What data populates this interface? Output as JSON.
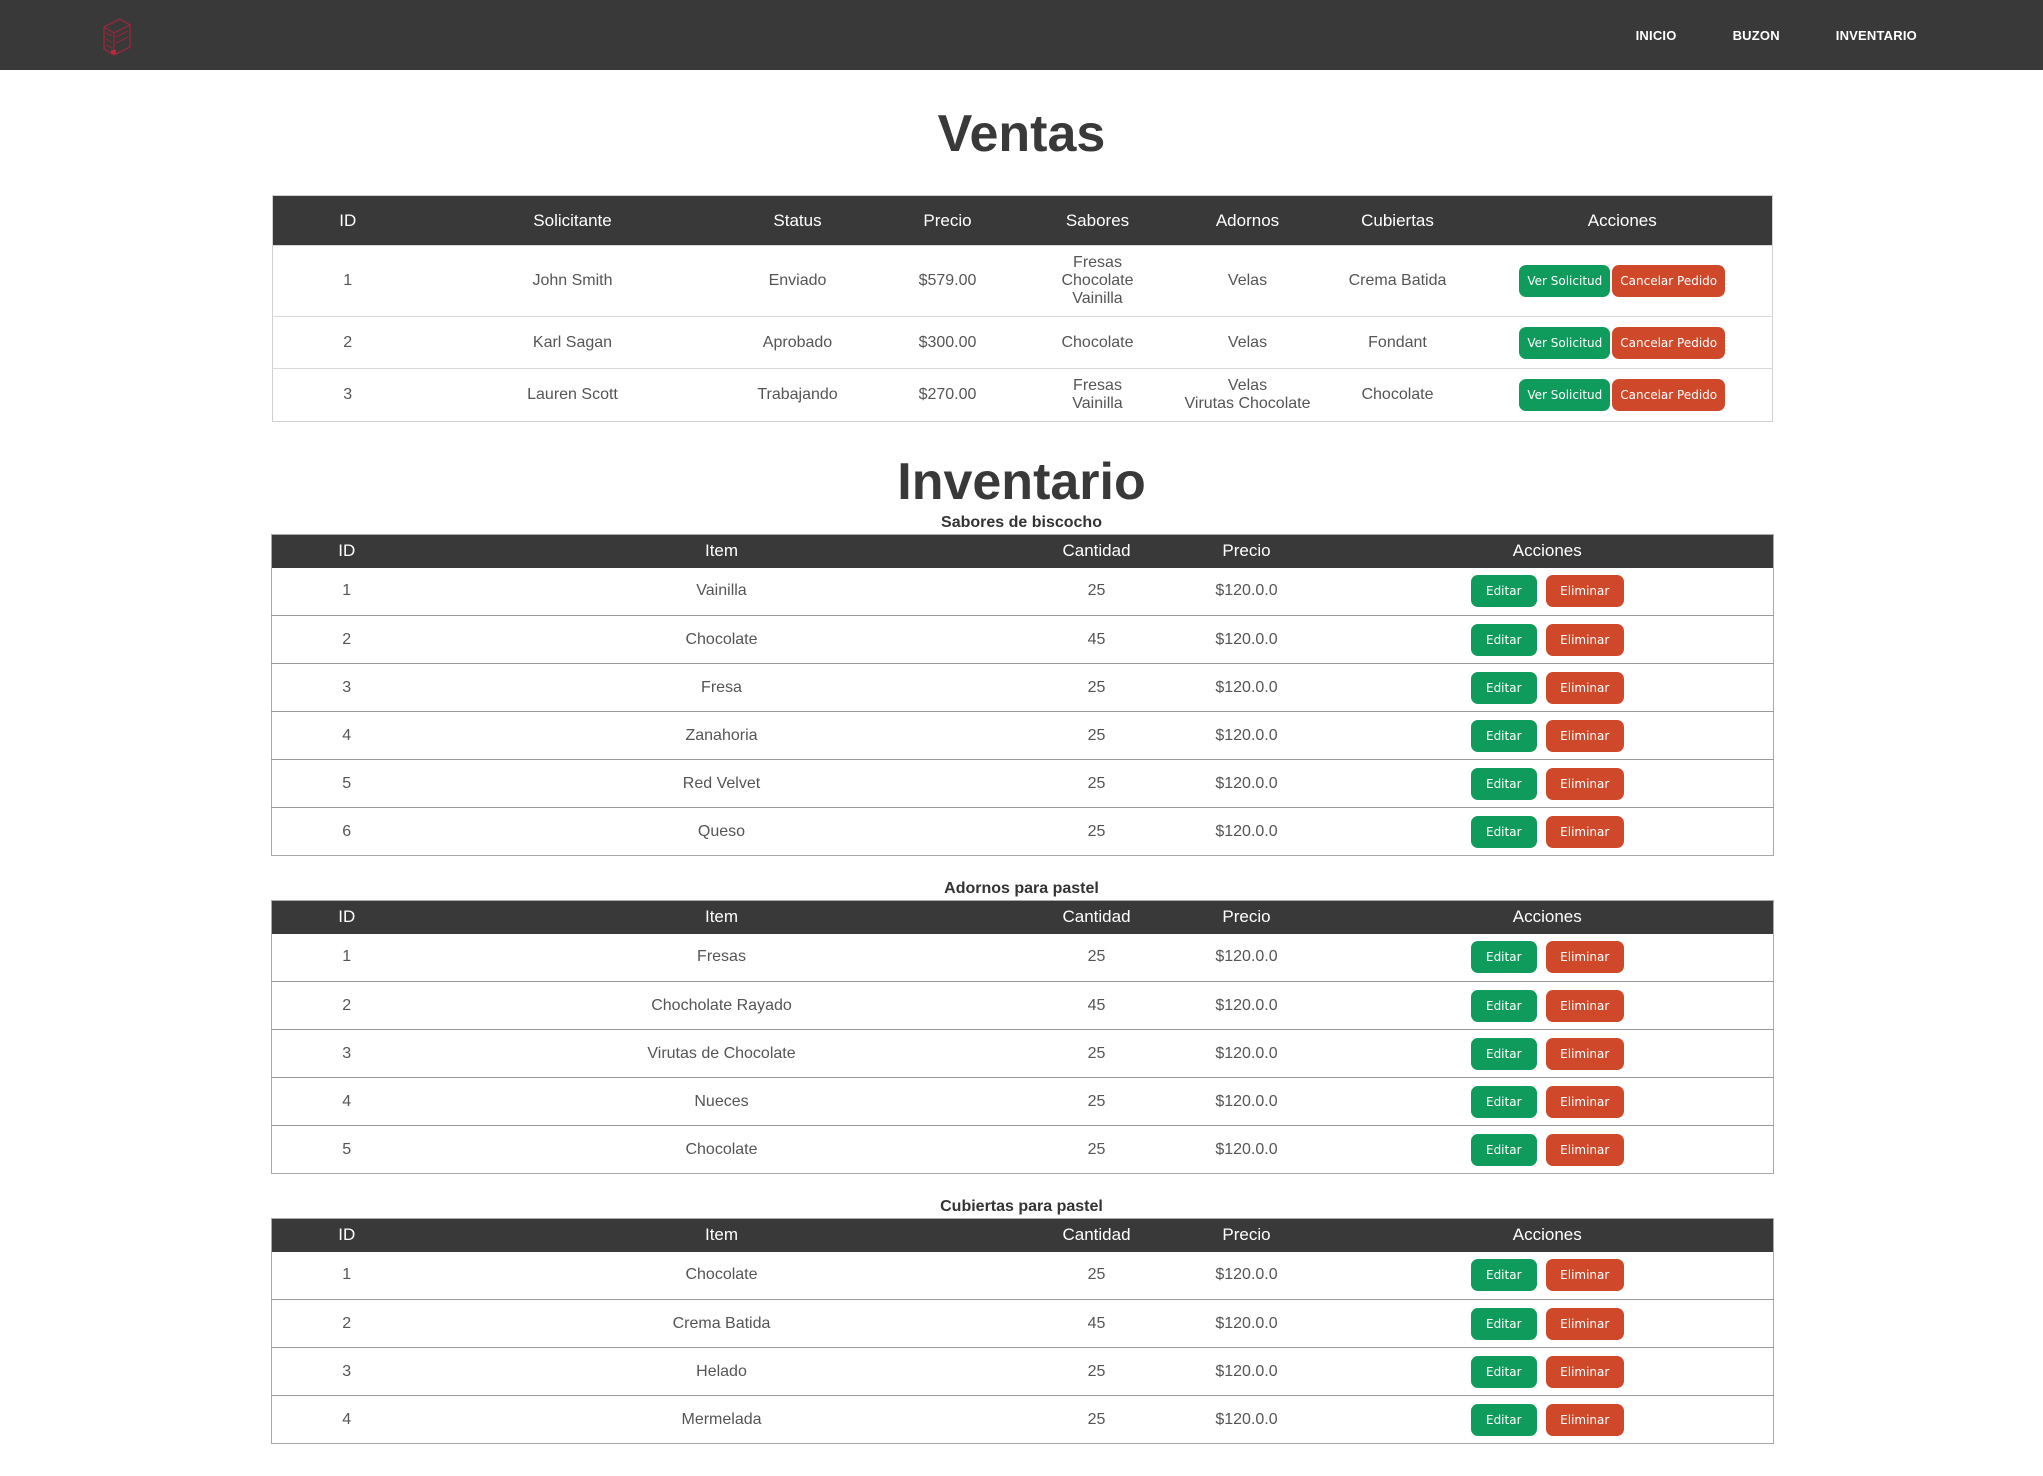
{
  "nav": {
    "logo_icon": "cake-logo-icon",
    "links": [
      "INICIO",
      "BUZON",
      "INVENTARIO"
    ]
  },
  "ventas": {
    "title": "Ventas",
    "headers": [
      "ID",
      "Solicitante",
      "Status",
      "Precio",
      "Sabores",
      "Adornos",
      "Cubiertas",
      "Acciones"
    ],
    "rows": [
      {
        "id": "1",
        "solicitante": "John Smith",
        "status": "Enviado",
        "precio": "$579.00",
        "sabores": [
          "Fresas",
          "Chocolate",
          "Vainilla"
        ],
        "adornos": [
          "Velas"
        ],
        "cubiertas": "Crema Batida"
      },
      {
        "id": "2",
        "solicitante": "Karl Sagan",
        "status": "Aprobado",
        "precio": "$300.00",
        "sabores": [
          "Chocolate"
        ],
        "adornos": [
          "Velas"
        ],
        "cubiertas": "Fondant"
      },
      {
        "id": "3",
        "solicitante": "Lauren Scott",
        "status": "Trabajando",
        "precio": "$270.00",
        "sabores": [
          "Fresas",
          "Vainilla"
        ],
        "adornos": [
          "Velas",
          "Virutas Chocolate"
        ],
        "cubiertas": "Chocolate"
      }
    ],
    "ver_label": "Ver Solicitud",
    "cancelar_label": "Cancelar Pedido"
  },
  "inventario": {
    "title": "Inventario",
    "headers": [
      "ID",
      "Item",
      "Cantidad",
      "Precio",
      "Acciones"
    ],
    "edit_label": "Editar",
    "delete_label": "Eliminar",
    "sections": [
      {
        "subtitle": "Sabores de biscocho",
        "rows": [
          {
            "id": "1",
            "item": "Vainilla",
            "cantidad": "25",
            "precio": "$120.0.0"
          },
          {
            "id": "2",
            "item": "Chocolate",
            "cantidad": "45",
            "precio": "$120.0.0"
          },
          {
            "id": "3",
            "item": "Fresa",
            "cantidad": "25",
            "precio": "$120.0.0"
          },
          {
            "id": "4",
            "item": "Zanahoria",
            "cantidad": "25",
            "precio": "$120.0.0"
          },
          {
            "id": "5",
            "item": "Red Velvet",
            "cantidad": "25",
            "precio": "$120.0.0"
          },
          {
            "id": "6",
            "item": "Queso",
            "cantidad": "25",
            "precio": "$120.0.0"
          }
        ]
      },
      {
        "subtitle": "Adornos para pastel",
        "rows": [
          {
            "id": "1",
            "item": "Fresas",
            "cantidad": "25",
            "precio": "$120.0.0"
          },
          {
            "id": "2",
            "item": "Chocholate Rayado",
            "cantidad": "45",
            "precio": "$120.0.0"
          },
          {
            "id": "3",
            "item": "Virutas de Chocolate",
            "cantidad": "25",
            "precio": "$120.0.0"
          },
          {
            "id": "4",
            "item": "Nueces",
            "cantidad": "25",
            "precio": "$120.0.0"
          },
          {
            "id": "5",
            "item": "Chocolate",
            "cantidad": "25",
            "precio": "$120.0.0"
          }
        ]
      },
      {
        "subtitle": "Cubiertas para pastel",
        "rows": [
          {
            "id": "1",
            "item": "Chocolate",
            "cantidad": "25",
            "precio": "$120.0.0"
          },
          {
            "id": "2",
            "item": "Crema Batida",
            "cantidad": "45",
            "precio": "$120.0.0"
          },
          {
            "id": "3",
            "item": "Helado",
            "cantidad": "25",
            "precio": "$120.0.0"
          },
          {
            "id": "4",
            "item": "Mermelada",
            "cantidad": "25",
            "precio": "$120.0.0"
          }
        ]
      }
    ]
  },
  "colors": {
    "navbar": "#3a3939",
    "green_button": "#0f9b5c",
    "red_button": "#d0482a",
    "logo": "#8a2a3c"
  }
}
